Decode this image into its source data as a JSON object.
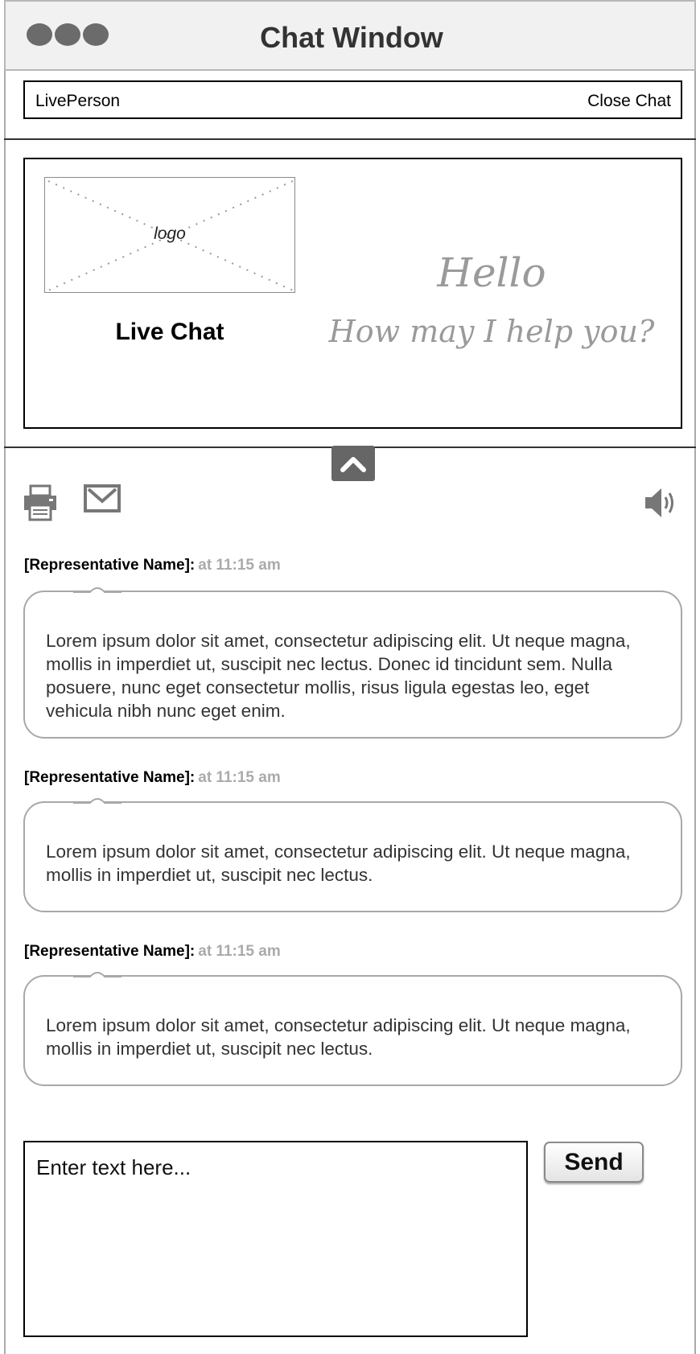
{
  "window": {
    "title": "Chat Window"
  },
  "topbar": {
    "brand": "LivePerson",
    "close_label": "Close Chat"
  },
  "header": {
    "logo_label": "logo",
    "product_name": "Live Chat",
    "greeting": "Hello",
    "prompt": "How may I help you?"
  },
  "toolbar": {
    "print_icon": "printer-icon",
    "email_icon": "envelope-icon",
    "sound_icon": "speaker-icon",
    "collapse_icon": "chevron-up-icon"
  },
  "messages": [
    {
      "sender": "[Representative Name]:",
      "time": "at 11:15 am",
      "text": "Lorem ipsum dolor sit amet, consectetur adipiscing elit. Ut neque magna, mollis in imperdiet ut, suscipit nec lectus. Donec id tincidunt sem. Nulla posuere, nunc eget consectetur mollis, risus ligula egestas leo, eget vehicula nibh nunc eget enim."
    },
    {
      "sender": "[Representative Name]:",
      "time": "at 11:15 am",
      "text": "Lorem ipsum dolor sit amet, consectetur adipiscing elit. Ut neque magna, mollis in imperdiet ut, suscipit nec lectus."
    },
    {
      "sender": "[Representative Name]:",
      "time": "at 11:15 am",
      "text": "Lorem ipsum dolor sit amet, consectetur adipiscing elit. Ut neque magna, mollis in imperdiet ut, suscipit nec lectus."
    }
  ],
  "composer": {
    "placeholder": "Enter text here...",
    "send_label": "Send"
  },
  "colors": {
    "window_border": "#aaaaaa",
    "title_bar": "#f1f1f1",
    "muted_text": "#9a9a9a",
    "bubble_border": "#a8a8a8"
  }
}
